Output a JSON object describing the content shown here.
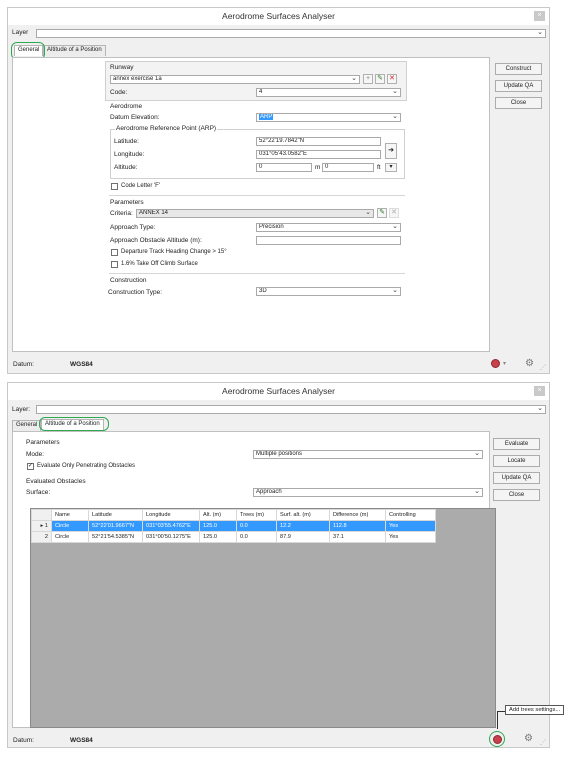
{
  "window_top": {
    "title": "Aerodrome Surfaces Analyser",
    "close_label": "×",
    "layer_label": "Layer",
    "tabs": [
      "General",
      "Altitude of a Position"
    ],
    "runway": {
      "section": "Runway",
      "selected": "annex exercise 1a",
      "code_label": "Code:",
      "code_value": "4"
    },
    "aerodrome": {
      "section": "Aerodrome",
      "datum_label": "Datum Elevation:",
      "datum_value": "ARP",
      "arp_group": "Aerodrome Reference Point (ARP)",
      "latitude_label": "Latitude:",
      "latitude_value": "52°22'19.7842\"N",
      "longitude_label": "Longitude:",
      "longitude_value": "031°05'43.0582\"E",
      "altitude_label": "Altitude:",
      "altitude_value": "0",
      "unit_m": "m",
      "altitude_value_ft": "0",
      "unit_ft": "ft",
      "code_letter_f": "Code Letter 'F'"
    },
    "parameters": {
      "section": "Parameters",
      "criteria_label": "Criteria:",
      "criteria_value": "ANNEX 14",
      "approach_type_label": "Approach Type:",
      "approach_type_value": "Precision",
      "approach_obstacle_label": "Approach Obstacle Altitude (m):",
      "departure_track": "Departure Track Heading Change > 15°",
      "take_off_climb": "1.6% Take Off Climb Surface"
    },
    "construction": {
      "section": "Construction",
      "type_label": "Construction Type:",
      "type_value": "3D"
    },
    "buttons": [
      "Construct",
      "Update QA",
      "Close"
    ],
    "status": {
      "datum_label": "Datum:",
      "datum_value": "WGS84"
    }
  },
  "window_bottom": {
    "title": "Aerodrome Surfaces Analyser",
    "close_label": "×",
    "layer_label": "Layer:",
    "tabs": [
      "General",
      "Altitude of a Position"
    ],
    "parameters": {
      "section": "Parameters",
      "mode_label": "Mode:",
      "mode_value": "Multiple positions",
      "evaluate_only": "Evaluate Only Penetrating Obstacles"
    },
    "evaluated": {
      "section": "Evaluated Obstacles",
      "surface_label": "Surface:",
      "surface_value": "Approach"
    },
    "table": {
      "columns": [
        "Name",
        "Latitude",
        "Longitude",
        "Alt. (m)",
        "Trees (m)",
        "Surf. alt. (m)",
        "Difference (m)",
        "Controlling"
      ],
      "rows": [
        {
          "num": "1",
          "cells": [
            "Circle",
            "52°22'01.9667\"N",
            "031°03'55.4762\"E",
            "125.0",
            "0.0",
            "12.2",
            "112.8",
            "Yes"
          ]
        },
        {
          "num": "2",
          "cells": [
            "Circle",
            "52°21'54.5385\"N",
            "031°00'50.1275\"E",
            "125.0",
            "0.0",
            "87.9",
            "37.1",
            "Yes"
          ]
        }
      ]
    },
    "buttons": [
      "Evaluate",
      "Locate",
      "Update QA",
      "Close"
    ],
    "tooltip": "Add trees settings...",
    "status": {
      "datum_label": "Datum:",
      "datum_value": "WGS84"
    }
  },
  "colors": {
    "highlight": "#3399ff",
    "ring": "#2fa84f",
    "grid_bg": "#ababab"
  }
}
